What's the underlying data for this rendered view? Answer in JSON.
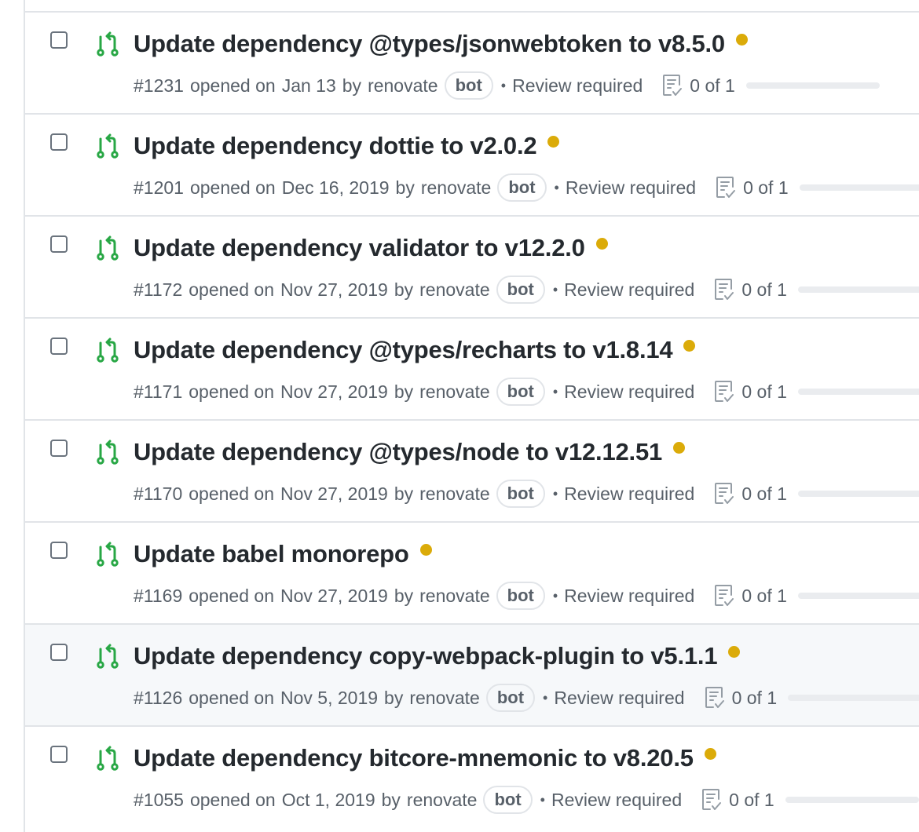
{
  "colors": {
    "open_icon": "#28a745",
    "status_pending": "#dbab09"
  },
  "icons": {
    "pr": "git-pull-request-icon",
    "tasks": "checklist-icon"
  },
  "pull_requests": [
    {
      "title": "Update dependency @types/jsonwebtoken to v8.5.0",
      "number": "#1231",
      "opened": "opened on",
      "date": "Jan 13",
      "by": "by",
      "author": "renovate",
      "label": "bot",
      "bullet": "•",
      "review": "Review required",
      "tasks": "0 of 1"
    },
    {
      "title": "Update dependency dottie to v2.0.2",
      "number": "#1201",
      "opened": "opened on",
      "date": "Dec 16, 2019",
      "by": "by",
      "author": "renovate",
      "label": "bot",
      "bullet": "•",
      "review": "Review required",
      "tasks": "0 of 1"
    },
    {
      "title": "Update dependency validator to v12.2.0",
      "number": "#1172",
      "opened": "opened on",
      "date": "Nov 27, 2019",
      "by": "by",
      "author": "renovate",
      "label": "bot",
      "bullet": "•",
      "review": "Review required",
      "tasks": "0 of 1"
    },
    {
      "title": "Update dependency @types/recharts to v1.8.14",
      "number": "#1171",
      "opened": "opened on",
      "date": "Nov 27, 2019",
      "by": "by",
      "author": "renovate",
      "label": "bot",
      "bullet": "•",
      "review": "Review required",
      "tasks": "0 of 1"
    },
    {
      "title": "Update dependency @types/node to v12.12.51",
      "number": "#1170",
      "opened": "opened on",
      "date": "Nov 27, 2019",
      "by": "by",
      "author": "renovate",
      "label": "bot",
      "bullet": "•",
      "review": "Review required",
      "tasks": "0 of 1"
    },
    {
      "title": "Update babel monorepo",
      "number": "#1169",
      "opened": "opened on",
      "date": "Nov 27, 2019",
      "by": "by",
      "author": "renovate",
      "label": "bot",
      "bullet": "•",
      "review": "Review required",
      "tasks": "0 of 1"
    },
    {
      "title": "Update dependency copy-webpack-plugin to v5.1.1",
      "number": "#1126",
      "opened": "opened on",
      "date": "Nov 5, 2019",
      "by": "by",
      "author": "renovate",
      "label": "bot",
      "bullet": "•",
      "review": "Review required",
      "tasks": "0 of 1",
      "hovered": true
    },
    {
      "title": "Update dependency bitcore-mnemonic to v8.20.5",
      "number": "#1055",
      "opened": "opened on",
      "date": "Oct 1, 2019",
      "by": "by",
      "author": "renovate",
      "label": "bot",
      "bullet": "•",
      "review": "Review required",
      "tasks": "0 of 1"
    }
  ]
}
